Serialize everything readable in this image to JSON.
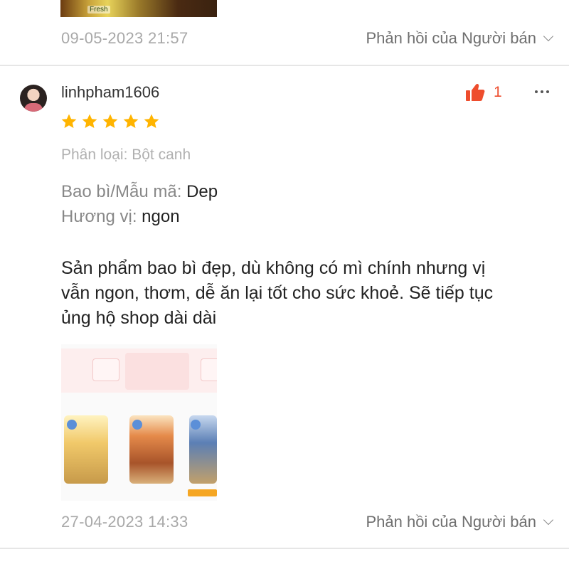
{
  "previous_review": {
    "image_tag": "Fresh",
    "timestamp": "09-05-2023 21:57",
    "reply_label": "Phản hồi của Người bán"
  },
  "review": {
    "username": "linhpham1606",
    "rating": 5,
    "like_count": "1",
    "more_icon": "more-horizontal-icon",
    "like_icon": "thumbs-up-icon",
    "like_color": "#ee4d2d",
    "star_color": "#ffb400",
    "variation": "Phân loại: Bột canh",
    "attributes": [
      {
        "label": "Bao bì/Mẫu mã:",
        "value": "Dep"
      },
      {
        "label": "Hương vị:",
        "value": "ngon"
      }
    ],
    "body_line_1": "Sản phẩm bao bì đẹp, dù không có mì chính nhưng vị",
    "body_line_2": "vẫn ngon, thơm, dễ ăn lại tốt cho sức khoẻ. Sẽ tiếp tục",
    "body_line_3": "ủng hộ shop dài dài",
    "timestamp": "27-04-2023 14:33",
    "reply_label": "Phản hồi của Người bán"
  }
}
